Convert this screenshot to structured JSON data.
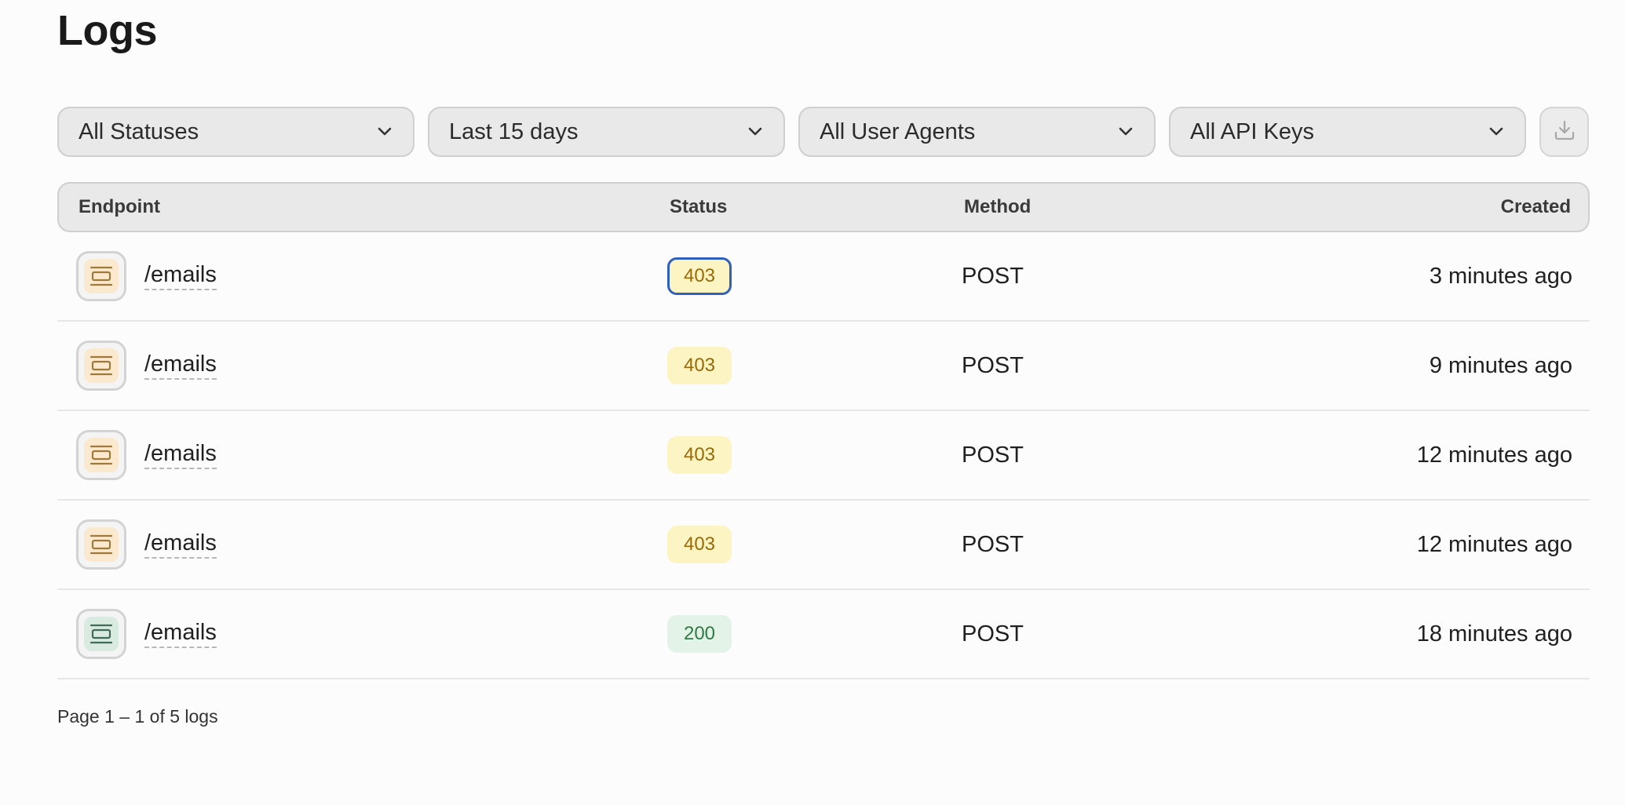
{
  "page": {
    "title": "Logs"
  },
  "filters": [
    {
      "label": "All Statuses"
    },
    {
      "label": "Last 15 days"
    },
    {
      "label": "All User Agents"
    },
    {
      "label": "All API Keys"
    }
  ],
  "table": {
    "headers": {
      "endpoint": "Endpoint",
      "status": "Status",
      "method": "Method",
      "created": "Created"
    },
    "rows": [
      {
        "endpoint": "/emails",
        "status": "403",
        "status_kind": "warn",
        "method": "POST",
        "created": "3 minutes ago"
      },
      {
        "endpoint": "/emails",
        "status": "403",
        "status_kind": "warn",
        "method": "POST",
        "created": "9 minutes ago"
      },
      {
        "endpoint": "/emails",
        "status": "403",
        "status_kind": "warn",
        "method": "POST",
        "created": "12 minutes ago"
      },
      {
        "endpoint": "/emails",
        "status": "403",
        "status_kind": "warn",
        "method": "POST",
        "created": "12 minutes ago"
      },
      {
        "endpoint": "/emails",
        "status": "200",
        "status_kind": "ok",
        "method": "POST",
        "created": "18 minutes ago"
      }
    ]
  },
  "pagination": {
    "summary": "Page 1 – 1 of 5 logs"
  },
  "icons": {
    "filter_chevron": "chevron-down-icon",
    "download": "download-icon",
    "endpoint": "email-endpoint-icon"
  },
  "colors": {
    "warn_bg": "#fdf4c4",
    "warn_text": "#9a6a06",
    "ok_bg": "#e4f3e7",
    "ok_text": "#2f7a45",
    "focus_ring": "#2f5fbf"
  }
}
